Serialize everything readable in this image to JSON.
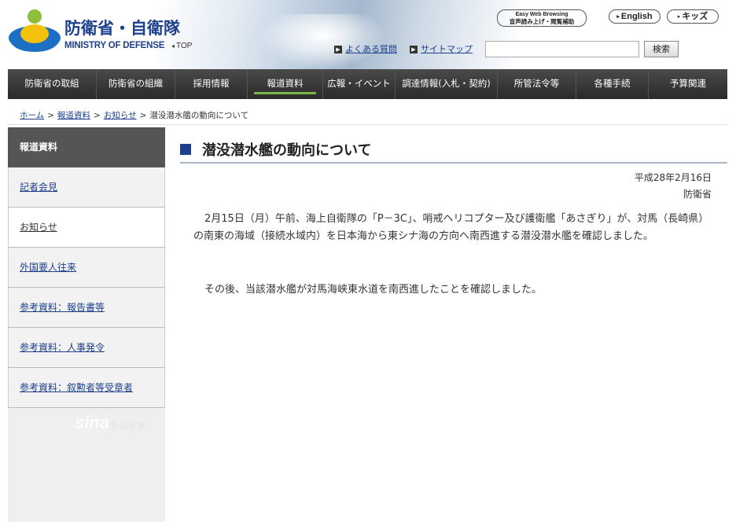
{
  "header": {
    "logo_jp": "防衛省・自衛隊",
    "logo_en": "MINISTRY OF DEFENSE",
    "top_link": "TOP",
    "faq_link": "よくある質問",
    "sitemap_link": "サイトマップ",
    "search_button": "検索",
    "search_value": "",
    "easy_web_line1": "Easy Web Browsing",
    "easy_web_line2": "音声読み上げ・閲覧補助",
    "english_button": "English",
    "kids_button": "キッズ"
  },
  "nav": {
    "items": [
      {
        "label": "防衛省の取組"
      },
      {
        "label": "防衛省の組織"
      },
      {
        "label": "採用情報"
      },
      {
        "label": "報道資料"
      },
      {
        "label": "広報・イベント"
      },
      {
        "label": "調達情報(入札・契約)"
      },
      {
        "label": "所管法令等"
      },
      {
        "label": "各種手続"
      },
      {
        "label": "予算関連"
      }
    ],
    "active": "報道資料"
  },
  "breadcrumb": {
    "home": "ホーム",
    "press": "報道資料",
    "notice": "お知らせ",
    "current": "潜没潜水艦の動向について",
    "separator": ">"
  },
  "sidebar": {
    "heading": "報道資料",
    "items": [
      {
        "label": "記者会見"
      },
      {
        "label": "お知らせ"
      },
      {
        "label": "外国要人往来"
      },
      {
        "label": "参考資料：報告書等"
      },
      {
        "label": "参考資料：人事発令"
      },
      {
        "label": "参考資料：叙勲者等受章者"
      }
    ],
    "current": "お知らせ",
    "watermark": "sina",
    "watermark_sub": "新浪军事"
  },
  "article": {
    "title": "潜没潜水艦の動向について",
    "date": "平成28年2月16日",
    "org": "防衛省",
    "paragraph1": "2月15日（月）午前、海上自衛隊の「P－3C」、哨戒ヘリコプター及び護衛艦「あさぎり」が、対馬（長崎県）の南東の海域（接続水域内）を日本海から東シナ海の方向へ南西進する潜没潜水艦を確認しました。",
    "paragraph2": "その後、当該潜水艦が対馬海峡東水道を南西進したことを確認しました。"
  },
  "colors": {
    "brand_blue": "#1d3f8c",
    "nav_dark": "#333333",
    "nav_active_accent": "#7ab84a",
    "sidebar_head": "#555555"
  }
}
